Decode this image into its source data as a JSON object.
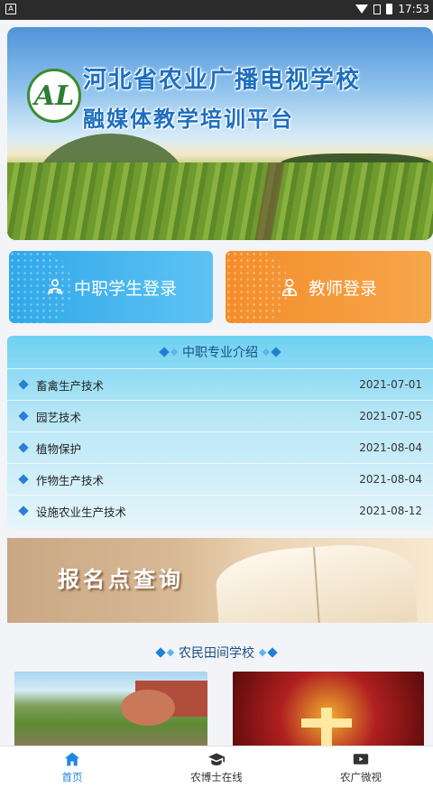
{
  "status_bar": {
    "time": "17:53"
  },
  "banner": {
    "title_line1": "河北省农业广播电视学校",
    "title_line2": "融媒体教学培训平台"
  },
  "login": {
    "student_label": "中职学生登录",
    "teacher_label": "教师登录"
  },
  "majors": {
    "heading": "中职专业介绍",
    "items": [
      {
        "name": "畜禽生产技术",
        "date": "2021-07-01"
      },
      {
        "name": "园艺技术",
        "date": "2021-07-05"
      },
      {
        "name": "植物保护",
        "date": "2021-08-04"
      },
      {
        "name": "作物生产技术",
        "date": "2021-08-04"
      },
      {
        "name": "设施农业生产技术",
        "date": "2021-08-12"
      }
    ]
  },
  "signup_banner": {
    "text": "报名点查询"
  },
  "field_school": {
    "heading": "农民田间学校"
  },
  "tabbar": {
    "items": [
      {
        "label": "首页",
        "icon": "home-icon",
        "active": true
      },
      {
        "label": "农博士在线",
        "icon": "graduation-cap-icon",
        "active": false
      },
      {
        "label": "农广微视",
        "icon": "video-icon",
        "active": false
      }
    ]
  },
  "colors": {
    "accent_blue": "#1e88e5",
    "student_btn": "#2fa8ea",
    "teacher_btn": "#f48d2a"
  }
}
